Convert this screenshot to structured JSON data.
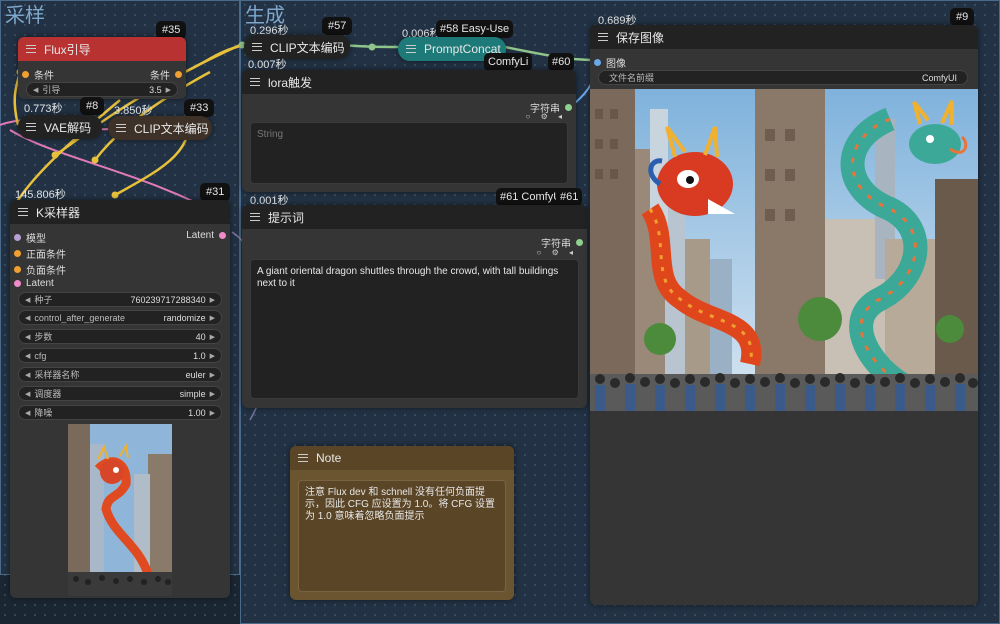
{
  "groups": {
    "sampling": "采样",
    "generate": "生成"
  },
  "nodes": {
    "flux_guidance": {
      "id": "#35",
      "title": "Flux引导",
      "in_slot": "条件",
      "out_slot": "条件",
      "widget": {
        "label": "引导",
        "value": "3.5"
      }
    },
    "vae_decode": {
      "id": "#8",
      "title": "VAE解码",
      "timing": "0.773秒"
    },
    "clip_encode_33": {
      "id": "#33",
      "title": "CLIP文本编码",
      "timing": "3.850秒"
    },
    "ksampler": {
      "id": "#31",
      "title": "K采样器",
      "timing": "145.806秒",
      "inputs": [
        "模型",
        "正面条件",
        "负面条件",
        "Latent"
      ],
      "output": "Latent",
      "widgets": [
        {
          "label": "种子",
          "value": "760239717288340"
        },
        {
          "label": "control_after_generate",
          "value": "randomize"
        },
        {
          "label": "步数",
          "value": "40"
        },
        {
          "label": "cfg",
          "value": "1.0"
        },
        {
          "label": "采样器名称",
          "value": "euler"
        },
        {
          "label": "调度器",
          "value": "simple"
        },
        {
          "label": "降噪",
          "value": "1.00"
        }
      ]
    },
    "clip_encode_57": {
      "id": "#57",
      "title": "CLIP文本编码",
      "timing": "0.296秒"
    },
    "prompt_concat": {
      "id": "#58",
      "title": "PromptConcat",
      "timing": "0.006秒",
      "badge_suffix": "Easy-Use"
    },
    "lora_trigger": {
      "id": "#60",
      "title": "lora触发",
      "timing": "0.007秒",
      "badge_label": "ComfyLi",
      "out_slot": "字符串",
      "placeholder": "String"
    },
    "prompt": {
      "id": "#61",
      "title": "提示词",
      "timing": "0.001秒",
      "badge_label": "ComfyUI",
      "out_slot": "字符串",
      "text": "A giant oriental dragon shuttles through the crowd, with tall buildings next to it"
    },
    "save_image": {
      "id": "#9",
      "title": "保存图像",
      "timing": "0.689秒",
      "in_slot": "图像",
      "widget": {
        "label": "文件名前缀",
        "value": "ComfyUI"
      }
    },
    "note": {
      "title": "Note",
      "text": "注意 Flux dev 和 schnell 没有任何负面提示，因此 CFG 应设置为 1.0。将 CFG 设置为 1.0 意味着忽略负面提示"
    }
  },
  "colors": {
    "flux_header": "#b83232",
    "prompt_concat": "#1d7a78",
    "note_bg": "#6b5530",
    "wire_yellow": "#e8c13a",
    "wire_pink": "#e07ab8",
    "wire_green": "#8fc48a",
    "wire_purple": "#b7a0d8",
    "slot_orange": "#f0a030",
    "slot_blue": "#6aa8e8"
  }
}
